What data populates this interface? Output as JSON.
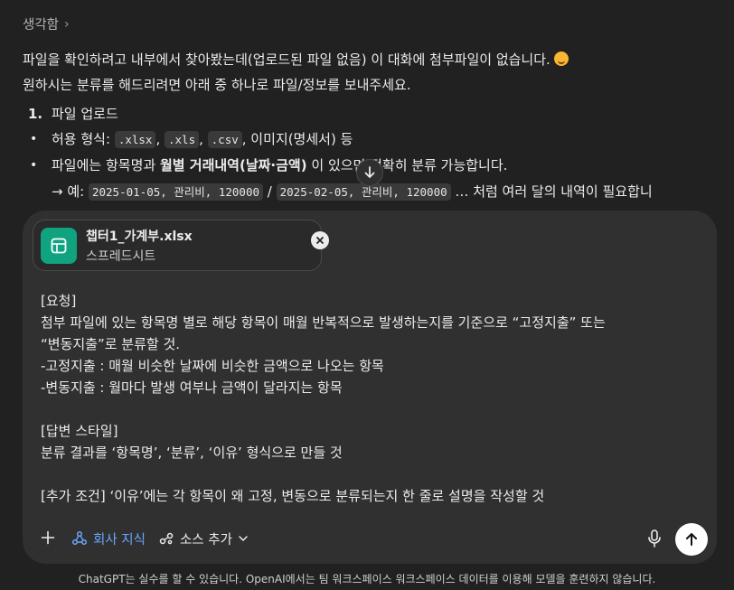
{
  "response": {
    "thinking_label": "생각함",
    "line1": "파일을 확인하려고 내부에서 찾아봤는데(업로드된 파일 없음) 이 대화에 첨부파일이 없습니다.",
    "line2": "원하시는 분류를 해드리려면 아래 중 하나로 파일/정보를 보내주세요.",
    "list": {
      "number": "1.",
      "item": "파일 업로드"
    },
    "bullet1": {
      "prefix": "허용 형식:",
      "code1": ".xlsx",
      "code2": ".xls",
      "code3": ".csv",
      "suffix": ", 이미지(명세서) 등"
    },
    "bullet2": {
      "prefix": "파일에는 항목명과",
      "bold": "월별 거래내역(날짜·금액)",
      "suffix": "이 있으면 정확히 분류 가능합니다."
    },
    "example": {
      "prefix": "→ 예:",
      "code1": "2025-01-05, 관리비, 120000",
      "sep": "/",
      "code2": "2025-02-05, 관리비, 120000",
      "suffix": "… 처럼 여러 달의 내역이 필요합니"
    }
  },
  "composer": {
    "attachment": {
      "file_name": "챕터1_가계부.xlsx",
      "file_type": "스프레드시트"
    },
    "prompt_lines": {
      "l1": "[요청]",
      "l2": "첨부 파일에 있는 항목명 별로 해당 항목이 매월 반복적으로 발생하는지를 기준으로 “고정지출” 또는",
      "l3": "“변동지출”로 분류할 것.",
      "l4": "-고정지출 : 매월 비슷한 날짜에 비슷한 금액으로 나오는 항목",
      "l5": "-변동지출 : 월마다 발생 여부나 금액이 달라지는 항목",
      "l6": "[답변 스타일]",
      "l7": "분류 결과를 ‘항목명’, ‘분류’, ‘이유’ 형식으로 만들 것",
      "l8": "[추가 조건] ‘이유’에는 각 항목이 왜 고정, 변동으로 분류되는지 한 줄로 설명을 작성할 것"
    },
    "toolbar": {
      "company_knowledge": "회사 지식",
      "add_source": "소스 추가"
    }
  },
  "footer": "ChatGPT는 실수를 할 수 있습니다. OpenAI에서는 팀 워크스페이스 워크스페이스 데이터를 이용해 모델을 훈련하지 않습니다.",
  "colors": {
    "background": "#212121",
    "composer": "#303030",
    "accent_blue": "#6aa7ff",
    "file_icon": "#10a37f"
  }
}
